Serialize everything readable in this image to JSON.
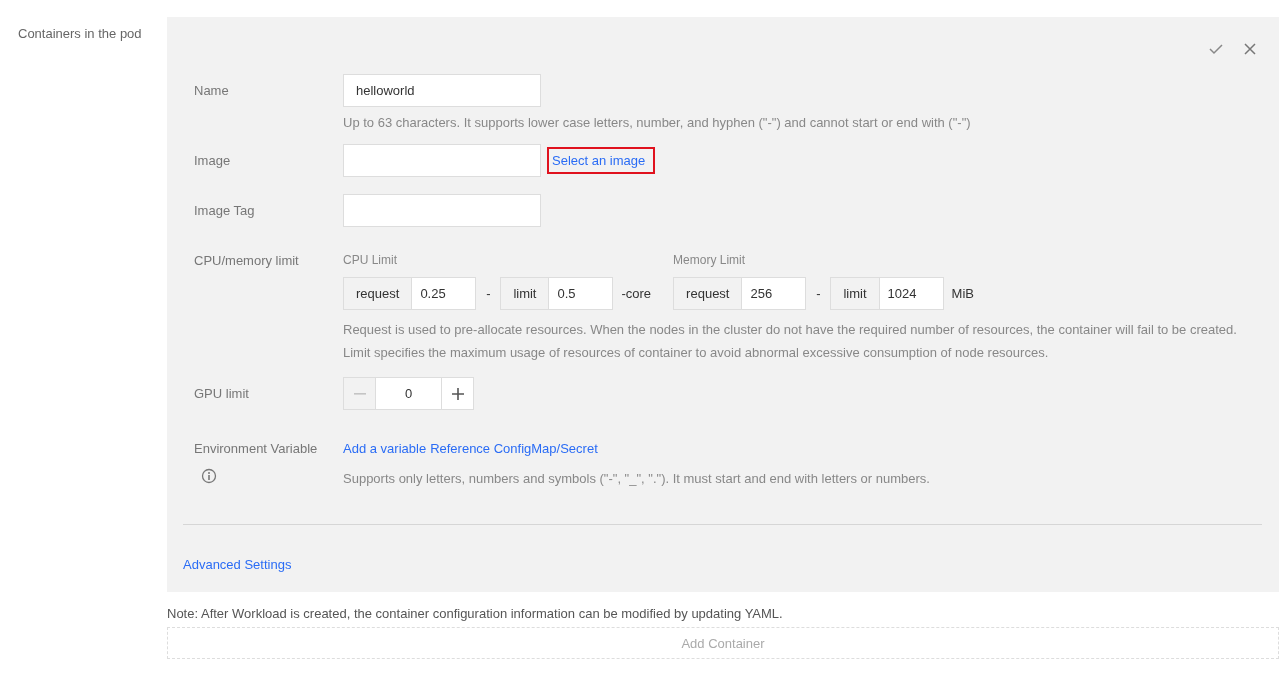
{
  "section_label": "Containers in the pod",
  "name": {
    "label": "Name",
    "value": "helloworld",
    "hint": "Up to 63 characters. It supports lower case letters, number, and hyphen (\"-\") and cannot start or end with (\"-\")"
  },
  "image": {
    "label": "Image",
    "link": "Select an image",
    "highlighted": true
  },
  "image_tag": {
    "label": "Image Tag"
  },
  "cpu_memory": {
    "label": "CPU/memory limit",
    "groups": [
      {
        "title": "CPU Limit",
        "request_label": "request",
        "request": "0.25",
        "separator": "-",
        "limit_label": "limit",
        "limit": "0.5",
        "unit": "-core"
      },
      {
        "title": "Memory Limit",
        "request_label": "request",
        "request": "256",
        "separator": "-",
        "limit_label": "limit",
        "limit": "1024",
        "unit": "MiB"
      }
    ],
    "help": [
      "Request is used to pre-allocate resources. When the nodes in the cluster do not have the required number of resources, the container will fail to be created.",
      "Limit specifies the maximum usage of resources of container to avoid abnormal excessive consumption of node resources."
    ]
  },
  "gpu": {
    "label": "GPU limit",
    "value": "0",
    "decrement_disabled": true
  },
  "env": {
    "label": "Environment Variable",
    "links": [
      "Add a variable",
      "Reference ConfigMap/Secret"
    ],
    "hint": "Supports only letters, numbers and symbols (\"-\", \"_\", \".\"). It must start and end with letters or numbers."
  },
  "advanced_settings": "Advanced Settings",
  "note": "Note: After Workload is created, the container configuration information can be modified by updating YAML.",
  "add_container": "Add Container"
}
